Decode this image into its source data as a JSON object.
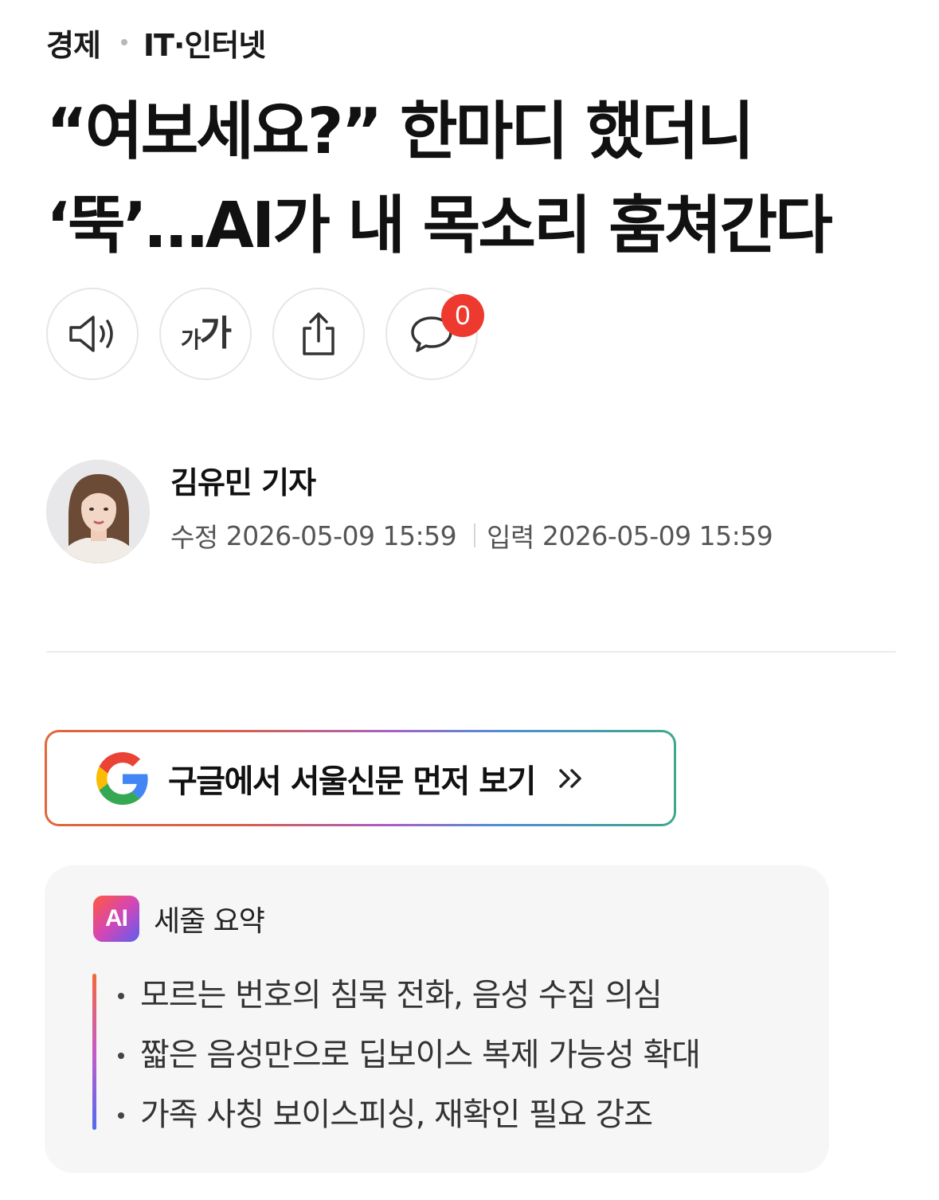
{
  "breadcrumb": {
    "section": "경제",
    "subsection": "IT·인터넷"
  },
  "headline": {
    "line1": "“여보세요?” 한마디 했더니",
    "line2": "‘뚝’…AI가 내 목소리 훔쳐간다"
  },
  "actions": {
    "listen_icon": "speaker-icon",
    "font_icon_small": "가",
    "font_icon_big": "가",
    "share_icon": "share-icon",
    "comment_icon": "comment-bubble-icon",
    "comment_count": "0"
  },
  "author": {
    "name": "김유민 기자",
    "modified_label": "수정",
    "modified": "2026-05-09 15:59",
    "published_label": "입력",
    "published": "2026-05-09 15:59"
  },
  "google_button": {
    "label": "구글에서 서울신문 먼저 보기",
    "icon": "google-g-icon",
    "arrow_icon": "double-chevron-right-icon"
  },
  "summary": {
    "badge": "AI",
    "title": "세줄 요약",
    "items": [
      "모르는 번호의 침묵 전화, 음성 수집 의심",
      "짧은 음성만으로 딥보이스 복제 가능성 확대",
      "가족 사칭 보이스피싱, 재확인 필요 강조"
    ]
  },
  "colors": {
    "badge_red": "#ee3a2e",
    "divider": "#ebebeb",
    "summary_bg": "#f6f6f6"
  }
}
